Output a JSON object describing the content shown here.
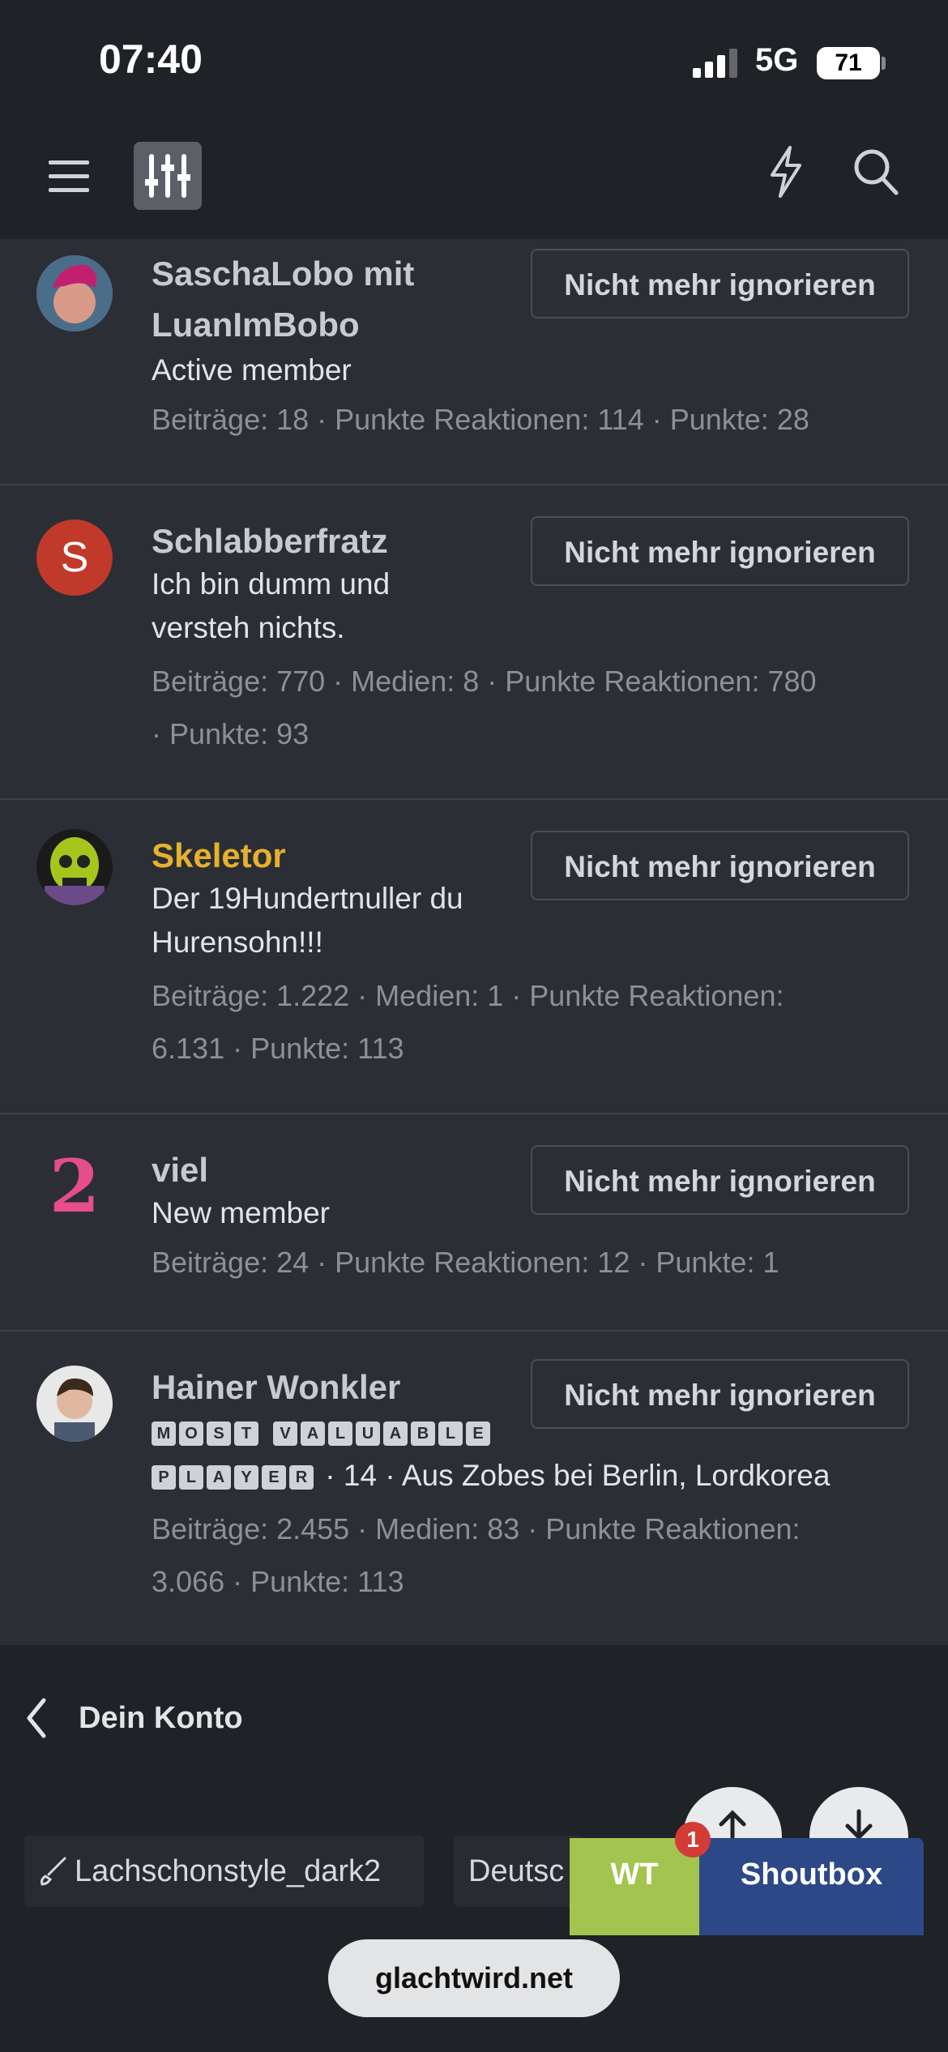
{
  "status_bar": {
    "time": "07:40",
    "network": "5G",
    "battery": "71"
  },
  "header": {
    "menu_icon": "hamburger-icon",
    "logo_icon": "sliders-icon",
    "bolt_icon": "lightning-icon",
    "search_icon": "search-icon"
  },
  "ignored_users": [
    {
      "name_line1": "SaschaLobo mit",
      "name_line2": "LuanImBobo",
      "title": "Active member",
      "stats": "Beiträge: 18 · Punkte Reaktionen: 114 · Punkte: 28",
      "button": "Nicht mehr ignorieren"
    },
    {
      "name": "Schlabberfratz",
      "avatar_letter": "S",
      "title_line1": "Ich bin dumm und",
      "title_line2": "versteh nichts.",
      "stats_line1": "Beiträge: 770 · Medien: 8 · Punkte Reaktionen: 780",
      "stats_line2": "· Punkte: 93",
      "button": "Nicht mehr ignorieren"
    },
    {
      "name": "Skeletor",
      "name_color": "#e6b12e",
      "title_line1": "Der 19Hundertnuller du",
      "title_line2": "Hurensohn!!!",
      "stats_line1": "Beiträge: 1.222 · Medien: 1 · Punkte Reaktionen:",
      "stats_line2": "6.131 · Punkte: 113",
      "button": "Nicht mehr ignorieren"
    },
    {
      "name": "viel",
      "avatar_glyph": "2",
      "title": "New member",
      "stats": "Beiträge: 24 · Punkte Reaktionen: 12 · Punkte: 1",
      "button": "Nicht mehr ignorieren"
    },
    {
      "name": "Hainer Wonkler",
      "title_tiles_line1": [
        "M",
        "O",
        "S",
        "T",
        " ",
        "V",
        "A",
        "L",
        "U",
        "A",
        "B",
        "L",
        "E"
      ],
      "title_tiles_line2": [
        "P",
        "L",
        "A",
        "Y",
        "E",
        "R"
      ],
      "title_rest": " · 14 · Aus Zobes bei Berlin, Lordkorea",
      "stats_line1": "Beiträge: 2.455 · Medien: 83 · Punkte Reaktionen:",
      "stats_line2": "3.066 · Punkte: 113",
      "button": "Nicht mehr ignorieren"
    }
  ],
  "footer": {
    "back_label": "Dein Konto",
    "style_label": "Lachschonstyle_dark2",
    "language_label": "Deutsc",
    "wt_label": "WT",
    "shoutbox_label": "Shoutbox",
    "badge_count": "1",
    "url": "glachtwird.net"
  }
}
